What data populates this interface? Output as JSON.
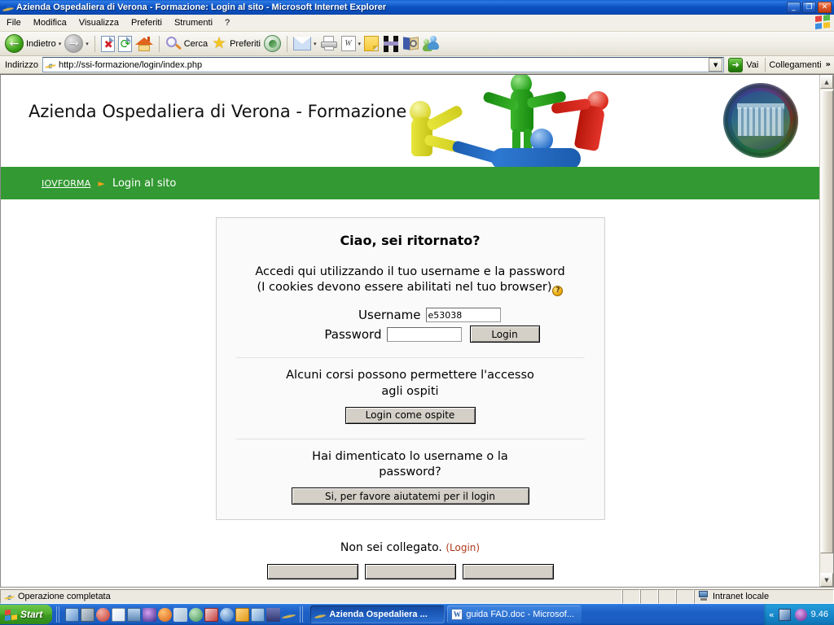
{
  "window": {
    "title": "Azienda Ospedaliera di Verona - Formazione: Login al sito - Microsoft Internet Explorer",
    "minimize": "_",
    "restore": "❐",
    "close": "✕"
  },
  "menubar": {
    "items": [
      "File",
      "Modifica",
      "Visualizza",
      "Preferiti",
      "Strumenti",
      "?"
    ]
  },
  "toolbar": {
    "back": "Indietro",
    "search": "Cerca",
    "favorites": "Preferiti",
    "caret": "▾"
  },
  "addressbar": {
    "label": "Indirizzo",
    "url": "http://ssi-formazione/login/index.php",
    "go": "Vai",
    "links": "Collegamenti",
    "links_chevron": "»",
    "dropdown_caret": "▼",
    "go_arrow": "➜"
  },
  "page": {
    "header_title": "Azienda Ospedaliera di Verona - Formazione",
    "breadcrumb": {
      "home": "IOVFORMA",
      "separator": "►",
      "current": "Login al sito"
    },
    "login": {
      "heading": "Ciao, sei ritornato?",
      "intro_line1": "Accedi qui utilizzando il tuo username e la password",
      "intro_line2": "(I cookies devono essere abilitati nel tuo browser)",
      "help_glyph": "?",
      "username_label": "Username",
      "username_value": "e53038",
      "password_label": "Password",
      "password_value": "",
      "login_button": "Login",
      "guest_text_line1": "Alcuni corsi possono permettere l'accesso",
      "guest_text_line2": "agli ospiti",
      "guest_button": "Login come ospite",
      "forgot_line1": "Hai dimenticato lo username o la",
      "forgot_line2": "password?",
      "forgot_button": "Si, per favore aiutatemi per il login"
    },
    "footer": {
      "not_logged": "Non sei collegato.",
      "login_link": "(Login)"
    }
  },
  "statusbar": {
    "message": "Operazione completata",
    "zone": "Intranet locale"
  },
  "taskbar": {
    "start": "Start",
    "tasks": [
      {
        "label": "Azienda Ospedaliera ...",
        "icon": "ie-icon",
        "active": "true"
      },
      {
        "label": "guida FAD.doc - Microsof...",
        "icon": "word-icon",
        "active": "false"
      }
    ],
    "tray": {
      "chevron": "«",
      "clock": "9.46"
    }
  },
  "scrollbar": {
    "up": "▲",
    "down": "▼"
  },
  "colors": {
    "breadcrumb_green": "#339933",
    "titlebar_blue": "#0b50c0",
    "link_red": "#b03a1e",
    "accent_orange": "#f3a11a"
  }
}
